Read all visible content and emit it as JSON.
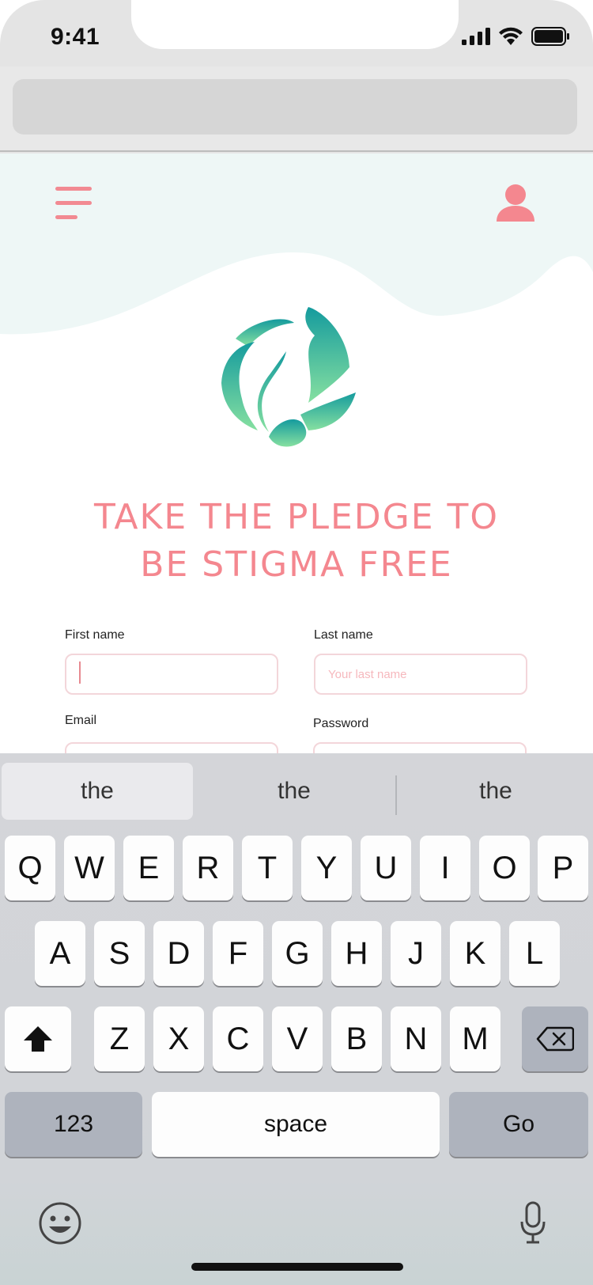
{
  "status_bar": {
    "time": "9:41"
  },
  "header": {
    "menu_icon": "hamburger-menu-icon",
    "profile_icon": "user-profile-icon"
  },
  "headline": {
    "line1": "TAKE THE PLEDGE TO",
    "line2": "BE STIGMA FREE"
  },
  "form": {
    "first_name_label": "First name",
    "first_name_value": "",
    "last_name_label": "Last name",
    "last_name_placeholder": "Your last name",
    "email_label": "Email",
    "password_label": "Password"
  },
  "keyboard": {
    "suggestions": [
      "the",
      "the",
      "the"
    ],
    "row1": [
      "Q",
      "W",
      "E",
      "R",
      "T",
      "Y",
      "U",
      "I",
      "O",
      "P"
    ],
    "row2": [
      "A",
      "S",
      "D",
      "F",
      "G",
      "H",
      "J",
      "K",
      "L"
    ],
    "row3": [
      "Z",
      "X",
      "C",
      "V",
      "B",
      "N",
      "M"
    ],
    "numbers_key": "123",
    "space_key": "space",
    "go_key": "Go"
  },
  "colors": {
    "accent": "#f4878f",
    "logo_teal": "#1aa5a0",
    "logo_green": "#7bd9a0",
    "wave": "#eef7f6"
  }
}
